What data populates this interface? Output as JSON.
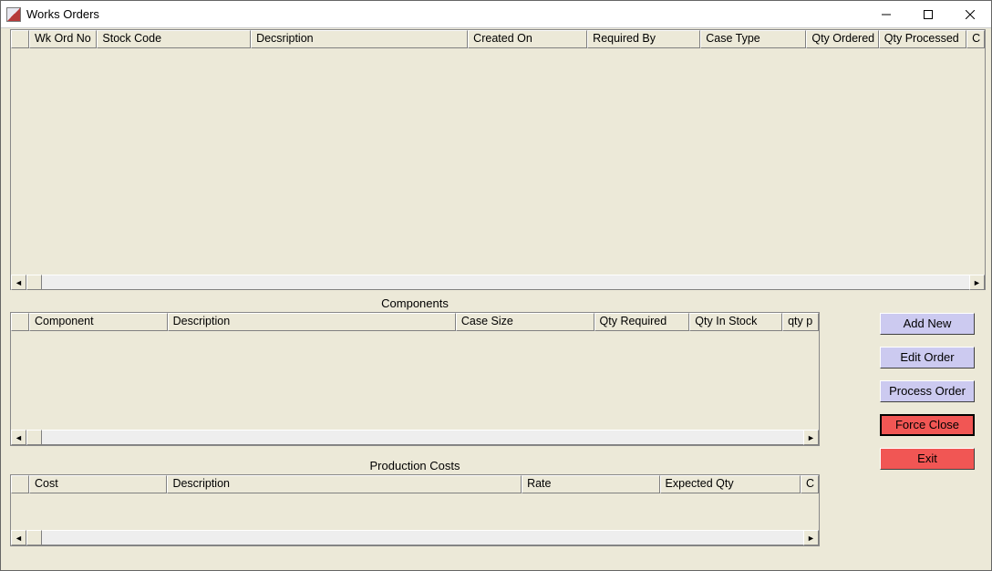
{
  "window": {
    "title": "Works Orders"
  },
  "gridTop": {
    "headers": [
      "",
      "Wk Ord No",
      "Stock Code",
      "Decsription",
      "Created On",
      "Required By",
      "Case Type",
      "Qty Ordered",
      "Qty Processed",
      "C"
    ]
  },
  "componentsSection": {
    "label": "Components",
    "headers": [
      "",
      "Component",
      "Description",
      "Case Size",
      "Qty Required",
      "Qty In Stock",
      "qty p"
    ]
  },
  "costsSection": {
    "label": "Production Costs",
    "headers": [
      "",
      "Cost",
      "Description",
      "Rate",
      "Expected Qty",
      "C"
    ]
  },
  "buttons": {
    "add_new": "Add New",
    "edit_order": "Edit Order",
    "process_order": "Process Order",
    "force_close": "Force Close",
    "exit": "Exit"
  }
}
